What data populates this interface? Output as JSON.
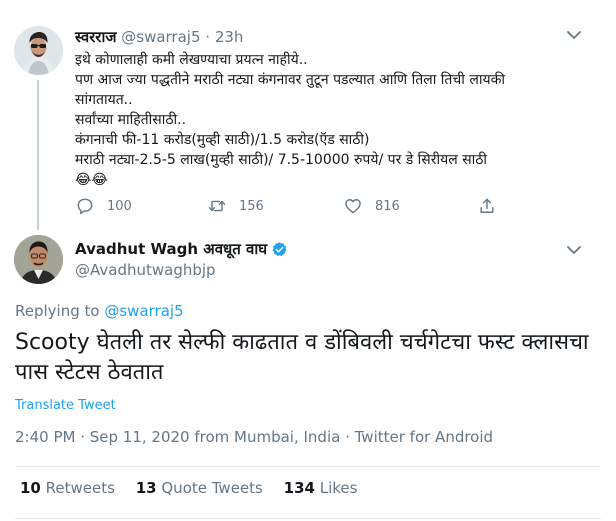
{
  "reply_tweet": {
    "display_name": "स्वरराज",
    "handle": "@swarraj5",
    "separator": "·",
    "time": "23h",
    "lines": [
      "इथे कोणालाही कमी लेखण्याचा प्रयत्न नाहीये..",
      "पण आज ज्या पद्धतीने मराठी नट्या कंगनावर तुटून पडल्यात आणि तिला तिची लायकी",
      "सांगतायत..",
      "सर्वांच्या माहितीसाठी..",
      "कंगनाची फी-11 करोड(मुव्ही साठी)/1.5 करोड(ऍड साठी)",
      "मराठी नट्या-2.5-5 लाख(मुव्ही साठी)/ 7.5-10000 रुपये/ पर डे सिरीयल साठी",
      "😂😂"
    ],
    "actions": {
      "reply_count": "100",
      "retweet_count": "156",
      "like_count": "816"
    }
  },
  "main_tweet": {
    "display_name": "Avadhut Wagh अवधूत वाघ",
    "handle": "@Avadhutwaghbjp",
    "replying_prefix": "Replying to",
    "replying_to": "@swarraj5",
    "text": "Scooty घेतली तर सेल्फी काढतात व डोंबिवली चर्चगेटचा फस्ट क्लासचा पास स्टेटस ठेवतात",
    "translate_label": "Translate Tweet",
    "meta": "2:40 PM · Sep 11, 2020 from Mumbai, India · Twitter for Android",
    "stats": {
      "retweets_count": "10",
      "retweets_label": "Retweets",
      "quotes_count": "13",
      "quotes_label": "Quote Tweets",
      "likes_count": "134",
      "likes_label": "Likes"
    }
  },
  "colors": {
    "accent": "#1da1f2",
    "muted": "#657786",
    "text": "#14171a",
    "border": "#e6ecf0",
    "verified": "#1da1f2"
  }
}
